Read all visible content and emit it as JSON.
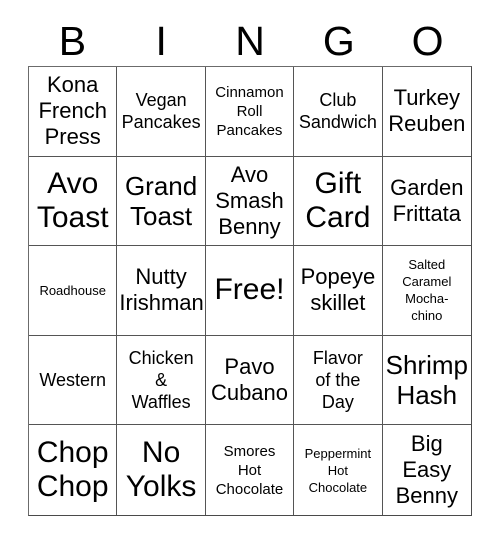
{
  "card": {
    "title": "BINGO",
    "free_space_label": "Free!",
    "header": {
      "letters": [
        "B",
        "I",
        "N",
        "G",
        "O"
      ]
    },
    "colors": {
      "background": "#ffffff",
      "text": "#000000",
      "grid_line": "#555555"
    },
    "grid": {
      "rows": 5,
      "columns": 5,
      "cells": [
        [
          {
            "text": "Kona\nFrench\nPress",
            "size": "lg"
          },
          {
            "text": "Vegan\nPancakes",
            "size": "md"
          },
          {
            "text": "Cinnamon\nRoll\nPancakes",
            "size": "sm"
          },
          {
            "text": "Club\nSandwich",
            "size": "md"
          },
          {
            "text": "Turkey\nReuben",
            "size": "lg"
          }
        ],
        [
          {
            "text": "Avo\nToast",
            "size": "xxl"
          },
          {
            "text": "Grand\nToast",
            "size": "xl"
          },
          {
            "text": "Avo\nSmash\nBenny",
            "size": "lg"
          },
          {
            "text": "Gift\nCard",
            "size": "xxl"
          },
          {
            "text": "Garden\nFrittata",
            "size": "lg"
          }
        ],
        [
          {
            "text": "Roadhouse",
            "size": "xs"
          },
          {
            "text": "Nutty\nIrishman",
            "size": "lg"
          },
          {
            "text": "Free!",
            "size": "xxl"
          },
          {
            "text": "Popeye\nskillet",
            "size": "lg"
          },
          {
            "text": "Salted\nCaramel\nMocha-\nchino",
            "size": "xs"
          }
        ],
        [
          {
            "text": "Western",
            "size": "md"
          },
          {
            "text": "Chicken\n&\nWaffles",
            "size": "md"
          },
          {
            "text": "Pavo\nCubano",
            "size": "lg"
          },
          {
            "text": "Flavor\nof the\nDay",
            "size": "md"
          },
          {
            "text": "Shrimp\nHash",
            "size": "xl"
          }
        ],
        [
          {
            "text": "Chop\nChop",
            "size": "xxl"
          },
          {
            "text": "No\nYolks",
            "size": "xxl"
          },
          {
            "text": "Smores\nHot\nChocolate",
            "size": "sm"
          },
          {
            "text": "Peppermint\nHot\nChocolate",
            "size": "xs"
          },
          {
            "text": "Big\nEasy\nBenny",
            "size": "lg"
          }
        ]
      ]
    }
  }
}
